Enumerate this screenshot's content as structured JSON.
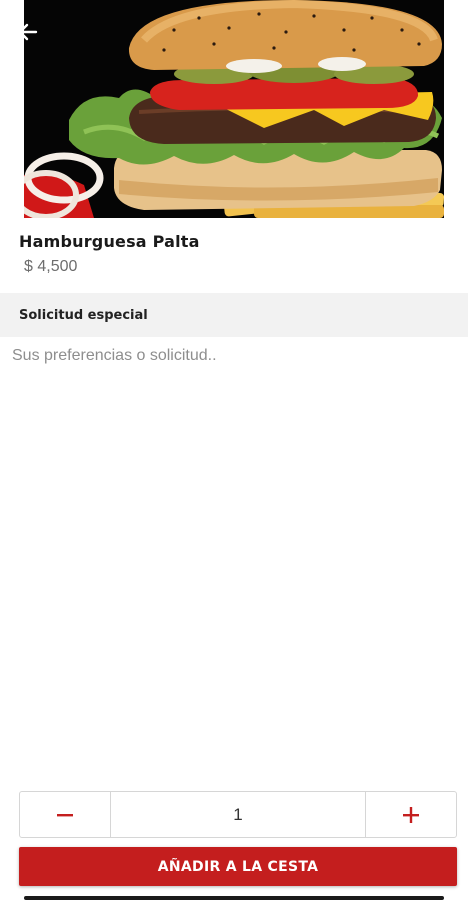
{
  "product": {
    "name": "Hamburguesa Palta",
    "price": "$ 4,500",
    "image_icon": "burger-photo"
  },
  "special_request": {
    "title": "Solicitud especial",
    "placeholder": "Sus preferencias o solicitud..",
    "value": ""
  },
  "quantity": {
    "value": "1",
    "minus_icon": "minus-icon",
    "plus_icon": "plus-icon"
  },
  "actions": {
    "add_to_cart_label": "AÑADIR A LA CESTA"
  },
  "colors": {
    "accent": "#c41e1e",
    "section_bg": "#f2f2f2"
  }
}
